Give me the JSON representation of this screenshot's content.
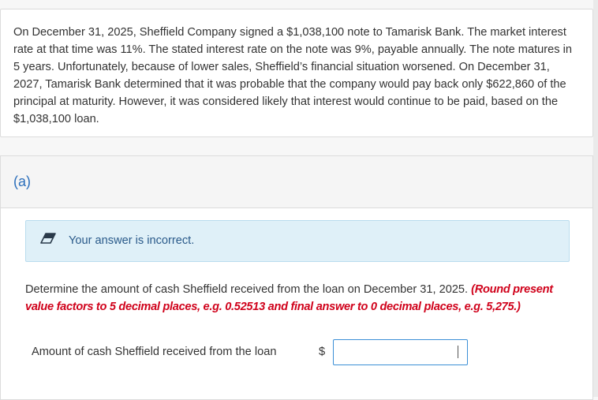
{
  "problem": {
    "text": "On December 31, 2025, Sheffield Company signed a $1,038,100 note to Tamarisk Bank. The market interest rate at that time was 11%. The stated interest rate on the note was 9%, payable annually. The note matures in 5 years. Unfortunately, because of lower sales, Sheffield’s financial situation worsened. On December 31, 2027, Tamarisk Bank determined that it was probable that the company would pay back only $622,860 of the principal at maturity. However, it was considered likely that interest would continue to be paid, based on the $1,038,100 loan."
  },
  "part": {
    "label": "(a)",
    "feedback": {
      "icon": "eraser-icon",
      "text": "Your answer is incorrect."
    },
    "question": {
      "text": "Determine the amount of cash Sheffield received from the loan on December 31, 2025. ",
      "hint": "(Round present value factors to 5 decimal places, e.g. 0.52513 and final answer to 0 decimal places, e.g. 5,275.)"
    },
    "answer": {
      "label": "Amount of cash Sheffield received from the loan",
      "currency": "$",
      "value": ""
    }
  },
  "colors": {
    "accent": "#2a6ebb",
    "feedback_bg": "#dff0f8",
    "hint_red": "#d0021b",
    "input_border": "#3b8fd6"
  }
}
